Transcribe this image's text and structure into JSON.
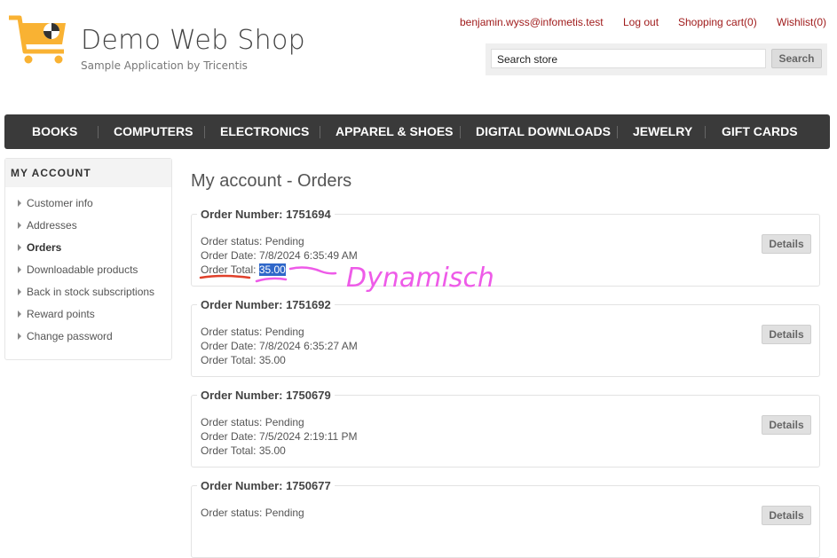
{
  "header": {
    "site_title": "Demo Web Shop",
    "tagline": "Sample Application by Tricentis",
    "user_email": "benjamin.wyss@infometis.test",
    "logout": "Log out",
    "cart": "Shopping cart(0)",
    "wishlist": "Wishlist(0)",
    "search_value": "Search store",
    "search_button": "Search"
  },
  "menu": [
    "BOOKS",
    "COMPUTERS",
    "ELECTRONICS",
    "APPAREL & SHOES",
    "DIGITAL DOWNLOADS",
    "JEWELRY",
    "GIFT CARDS"
  ],
  "sidebar": {
    "title": "MY ACCOUNT",
    "items": [
      "Customer info",
      "Addresses",
      "Orders",
      "Downloadable products",
      "Back in stock subscriptions",
      "Reward points",
      "Change password"
    ],
    "active": "Orders"
  },
  "page": {
    "title": "My account - Orders"
  },
  "orders": [
    {
      "number": "Order Number: 1751694",
      "status": "Order status: Pending",
      "date": "Order Date: 7/8/2024 6:35:49 AM",
      "total_label": "Order Total:",
      "total_value": "35.00",
      "details": "Details"
    },
    {
      "number": "Order Number: 1751692",
      "status": "Order status: Pending",
      "date": "Order Date: 7/8/2024 6:35:27 AM",
      "total_label": "Order Total:",
      "total_value": "35.00",
      "details": "Details"
    },
    {
      "number": "Order Number: 1750679",
      "status": "Order status: Pending",
      "date": "Order Date: 7/5/2024 2:19:11 PM",
      "total_label": "Order Total:",
      "total_value": "35.00",
      "details": "Details"
    },
    {
      "number": "Order Number: 1750677",
      "status": "Order status: Pending",
      "date": "",
      "total_label": "",
      "total_value": "",
      "details": "Details"
    }
  ],
  "annotation": {
    "text": "Dynamisch",
    "color": "#ee5be8",
    "underline_color": "#e0402a"
  },
  "colors": {
    "link": "#a01c1c",
    "menu_bg": "#3a3a3a",
    "logo": "#f9b233",
    "highlight": "#2f67c9"
  }
}
